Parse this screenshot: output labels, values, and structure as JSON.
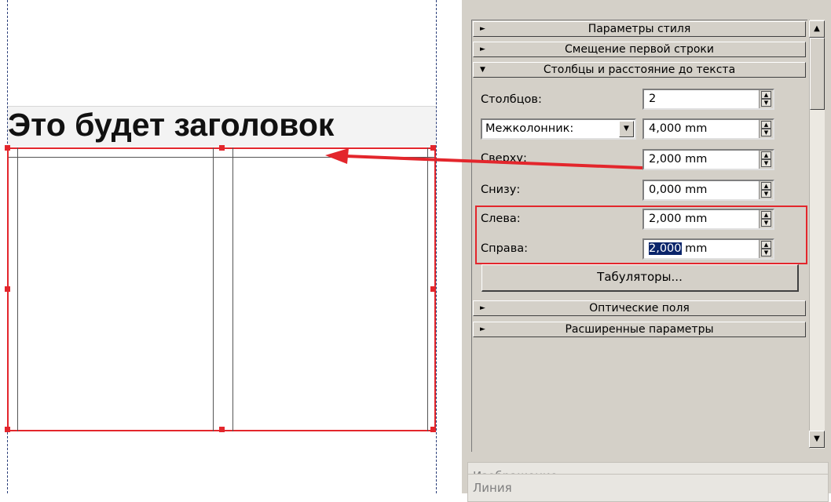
{
  "canvas": {
    "heading": "Это будет заголовок"
  },
  "panel": {
    "sections_top": [
      {
        "label": "Параметры стиля",
        "expanded": false
      },
      {
        "label": "Смещение первой строки",
        "expanded": false
      },
      {
        "label": "Столбцы и расстояние до текста",
        "expanded": true
      }
    ],
    "fields": {
      "columns_label": "Столбцов:",
      "columns_value": "2",
      "gutter_select": "Межколонник:",
      "gutter_value": "4,000  mm",
      "top_label": "Сверху:",
      "top_value": "2,000  mm",
      "bottom_label": "Снизу:",
      "bottom_value": "0,000  mm",
      "left_label": "Слева:",
      "left_value": "2,000  mm",
      "right_label": "Справа:",
      "right_value_selected": "2,000",
      "right_value_unit": " mm"
    },
    "tabs_button": "Табуляторы...",
    "sections_bottom": [
      {
        "label": "Оптические поля",
        "expanded": false
      },
      {
        "label": "Расширенные параметры",
        "expanded": false
      }
    ],
    "image_section": "Изображение",
    "line_section": "Линия"
  },
  "colors": {
    "annotation": "#e3262c",
    "panel_bg": "#d4d0c8"
  }
}
